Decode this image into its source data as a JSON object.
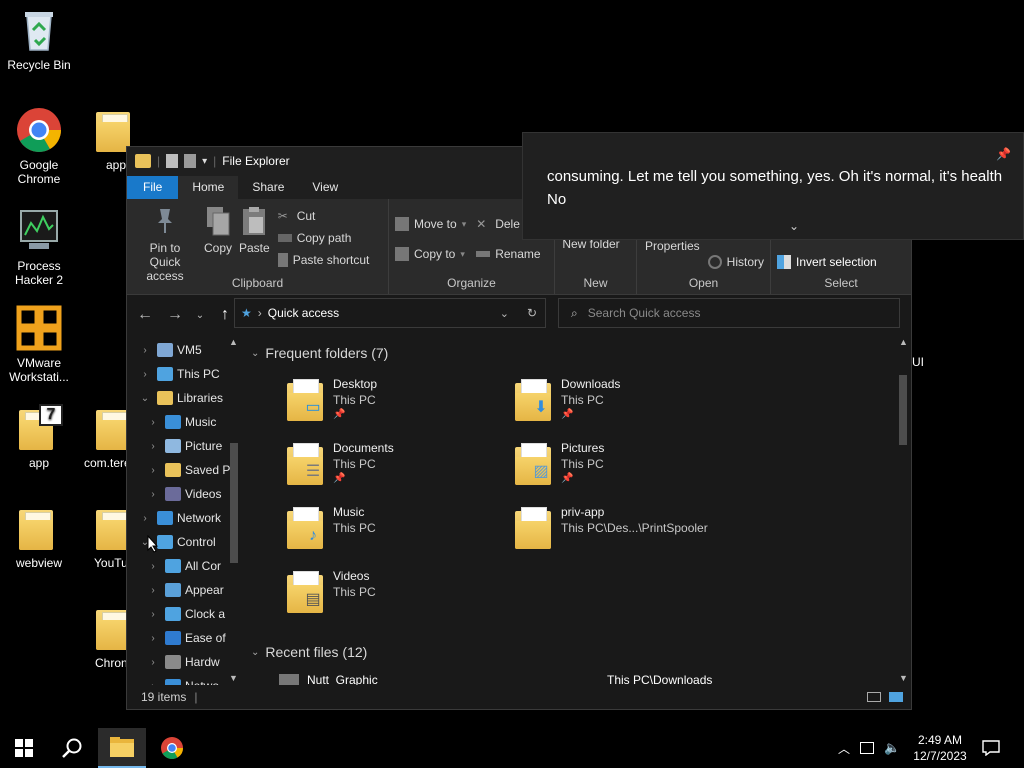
{
  "desktop": {
    "icons": [
      {
        "label": "Recycle Bin",
        "icon": "recycle-bin-icon"
      },
      {
        "label": "Google Chrome",
        "icon": "chrome-icon"
      },
      {
        "label": "Process Hacker 2",
        "icon": "process-hacker-icon"
      },
      {
        "label": "VMware Workstati...",
        "icon": "vmware-icon"
      },
      {
        "label": "app",
        "icon": "app-7zip-icon"
      },
      {
        "label": "webview",
        "icon": "folder-icon"
      },
      {
        "label": "app",
        "icon": "folder-icon"
      },
      {
        "label": "com.tere",
        "icon": "folder-icon"
      },
      {
        "label": "YouTu",
        "icon": "folder-icon"
      },
      {
        "label": "Chron",
        "icon": "folder-icon"
      },
      {
        "label": "UI",
        "icon": "text"
      }
    ]
  },
  "explorer": {
    "title": "File Explorer",
    "tabs": [
      "File",
      "Home",
      "Share",
      "View"
    ],
    "ribbon": {
      "clipboard": {
        "label": "Clipboard",
        "pin": "Pin to Quick access",
        "copy": "Copy",
        "paste": "Paste",
        "cut": "Cut",
        "copy_path": "Copy path",
        "paste_shortcut": "Paste shortcut"
      },
      "organize": {
        "label": "Organize",
        "move_to": "Move to",
        "copy_to": "Copy to",
        "delete": "Dele",
        "rename": "Rename"
      },
      "new": {
        "label": "New",
        "new_folder": "New folder"
      },
      "open": {
        "label": "Open",
        "properties": "Properties",
        "history": "History"
      },
      "select": {
        "label": "Select",
        "invert": "Invert selection"
      }
    },
    "address": {
      "path": "Quick access",
      "search_placeholder": "Search Quick access"
    },
    "nav": [
      {
        "label": "VM5",
        "indent": 0,
        "icon": "drive-icon",
        "color": "#7fa7d4",
        "chev": "›"
      },
      {
        "label": "This PC",
        "indent": 0,
        "icon": "this-pc-icon",
        "color": "#4fa3e0",
        "chev": "›"
      },
      {
        "label": "Libraries",
        "indent": 0,
        "icon": "libraries-icon",
        "color": "#e9c25a",
        "chev": "⌄"
      },
      {
        "label": "Music",
        "indent": 1,
        "icon": "music-icon",
        "color": "#3a8fd8",
        "chev": "›"
      },
      {
        "label": "Picture",
        "indent": 1,
        "icon": "pictures-icon",
        "color": "#8fb8e0",
        "chev": "›"
      },
      {
        "label": "Saved P",
        "indent": 1,
        "icon": "saved-pictures-icon",
        "color": "#e9c25a",
        "chev": "›"
      },
      {
        "label": "Videos",
        "indent": 1,
        "icon": "videos-icon",
        "color": "#6b6b9a",
        "chev": "›"
      },
      {
        "label": "Network",
        "indent": 0,
        "icon": "network-icon",
        "color": "#3a8fd8",
        "chev": "›"
      },
      {
        "label": "Control",
        "indent": 0,
        "icon": "control-panel-icon",
        "color": "#4fa3e0",
        "chev": "⌄"
      },
      {
        "label": "All Cor",
        "indent": 1,
        "icon": "control-panel-icon",
        "color": "#4fa3e0",
        "chev": "›"
      },
      {
        "label": "Appear",
        "indent": 1,
        "icon": "appearance-icon",
        "color": "#5aa0d8",
        "chev": "›"
      },
      {
        "label": "Clock a",
        "indent": 1,
        "icon": "clock-icon",
        "color": "#4fa3e0",
        "chev": "›"
      },
      {
        "label": "Ease of",
        "indent": 1,
        "icon": "ease-of-access-icon",
        "color": "#2f7bd0",
        "chev": "›"
      },
      {
        "label": "Hardw",
        "indent": 1,
        "icon": "hardware-icon",
        "color": "#8a8a8a",
        "chev": "›"
      },
      {
        "label": "Netwo",
        "indent": 1,
        "icon": "network-icon",
        "color": "#3a8fd8",
        "chev": "›"
      }
    ],
    "frequent": {
      "header": "Frequent folders (7)",
      "items": [
        {
          "name": "Desktop",
          "location": "This PC",
          "pinned": true,
          "overlay": "▭",
          "ovcolor": "#1f8de0"
        },
        {
          "name": "Downloads",
          "location": "This PC",
          "pinned": true,
          "overlay": "⬇",
          "ovcolor": "#2f8de0"
        },
        {
          "name": "Documents",
          "location": "This PC",
          "pinned": true,
          "overlay": "☰",
          "ovcolor": "#7a7a7a"
        },
        {
          "name": "Pictures",
          "location": "This PC",
          "pinned": true,
          "overlay": "▨",
          "ovcolor": "#5a9ad0"
        },
        {
          "name": "Music",
          "location": "This PC",
          "pinned": false,
          "overlay": "♪",
          "ovcolor": "#2f8de0"
        },
        {
          "name": "priv-app",
          "location": "This PC\\Des...\\PrintSpooler",
          "pinned": false,
          "overlay": "",
          "ovcolor": "#fff"
        },
        {
          "name": "Videos",
          "location": "This PC",
          "pinned": false,
          "overlay": "▤",
          "ovcolor": "#555"
        }
      ]
    },
    "recent": {
      "header": "Recent files (12)",
      "first_name": "Nutt_Graphic",
      "first_location": "This PC\\Downloads"
    },
    "status": {
      "count": "19 items"
    }
  },
  "caption": {
    "line1": "consuming. Let me tell you something, yes. Oh it's normal, it's health",
    "line2": "No"
  },
  "taskbar": {
    "time": "2:49 AM",
    "date": "12/7/2023"
  }
}
